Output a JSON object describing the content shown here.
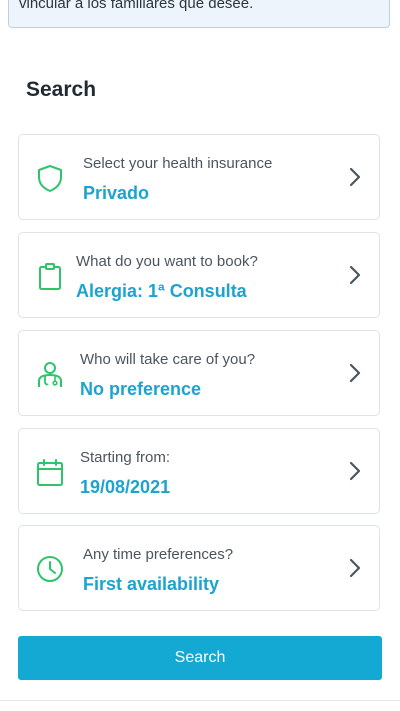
{
  "banner": {
    "text": "vincular a los familiares que desee."
  },
  "search": {
    "title": "Search",
    "cards": [
      {
        "label": "Select your health insurance",
        "value": "Privado",
        "icon": "shield-icon"
      },
      {
        "label": "What do you want to book?",
        "value": "Alergia: 1ª Consulta",
        "icon": "clipboard-icon"
      },
      {
        "label": "Who will take care of you?",
        "value": "No preference",
        "icon": "doctor-icon"
      },
      {
        "label": "Starting from:",
        "value": "19/08/2021",
        "icon": "calendar-icon"
      },
      {
        "label": "Any time preferences?",
        "value": "First availability",
        "icon": "clock-icon"
      }
    ],
    "button_label": "Search"
  },
  "colors": {
    "accent": "#14a9d3",
    "value_text": "#1ca3cf",
    "icon_green": "#2ec46a"
  }
}
